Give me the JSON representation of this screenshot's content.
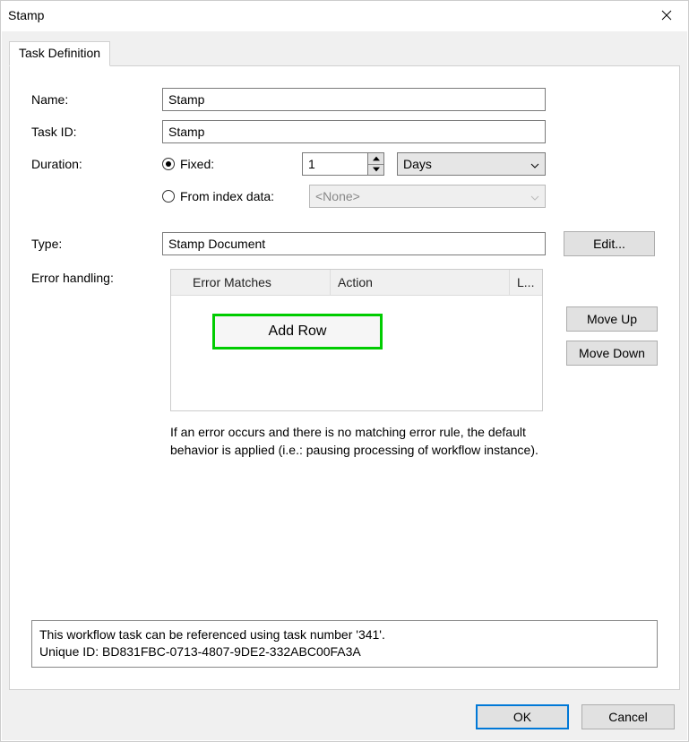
{
  "window": {
    "title": "Stamp"
  },
  "tab": {
    "label": "Task Definition"
  },
  "labels": {
    "name": "Name:",
    "taskid": "Task ID:",
    "duration": "Duration:",
    "type": "Type:",
    "errorhandling": "Error handling:"
  },
  "fields": {
    "name": "Stamp",
    "taskid": "Stamp",
    "duration_value": "1",
    "type": "Stamp Document"
  },
  "radio": {
    "fixed": "Fixed:",
    "fromindex": "From index data:"
  },
  "units": {
    "options": [
      "Days"
    ],
    "selected": "Days",
    "none_label": "<None>"
  },
  "buttons": {
    "edit": "Edit...",
    "addrow": "Add Row",
    "moveup": "Move Up",
    "movedown": "Move Down",
    "ok": "OK",
    "cancel": "Cancel"
  },
  "table": {
    "columns": {
      "match": "Error Matches",
      "action": "Action",
      "last": "L..."
    }
  },
  "note_text": "If an error occurs and there is no matching error rule, the default behavior is applied (i.e.: pausing processing of workflow instance).",
  "info": {
    "line1": "This workflow task can be referenced using task number '341'.",
    "line2": "Unique ID: BD831FBC-0713-4807-9DE2-332ABC00FA3A"
  }
}
